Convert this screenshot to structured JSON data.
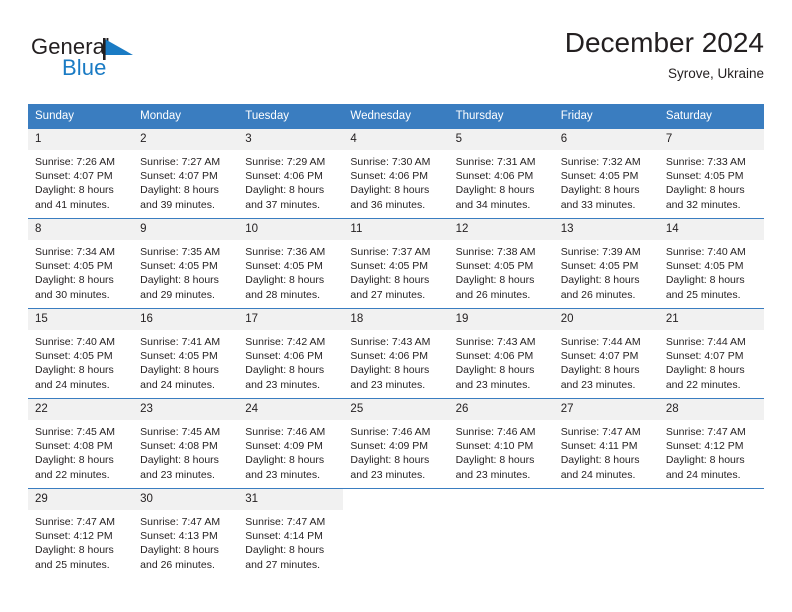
{
  "brand": {
    "name_part1": "General",
    "name_part2": "Blue",
    "flag_icon": "blue-flag-triangle-icon",
    "color_dark": "#231f20",
    "color_blue": "#1a7bc4"
  },
  "header": {
    "title": "December 2024",
    "subtitle": "Syrove, Ukraine"
  },
  "theme": {
    "header_row_bg": "#3a7dc0",
    "header_row_text": "#ffffff",
    "day_band_bg": "#f1f1f1",
    "grid_line": "#3a7dc0",
    "body_text": "#231f20"
  },
  "weekday_headers": [
    "Sunday",
    "Monday",
    "Tuesday",
    "Wednesday",
    "Thursday",
    "Friday",
    "Saturday"
  ],
  "weeks": [
    [
      {
        "day": "1",
        "sunrise": "Sunrise: 7:26 AM",
        "sunset": "Sunset: 4:07 PM",
        "daylight_line1": "Daylight: 8 hours",
        "daylight_line2": "and 41 minutes."
      },
      {
        "day": "2",
        "sunrise": "Sunrise: 7:27 AM",
        "sunset": "Sunset: 4:07 PM",
        "daylight_line1": "Daylight: 8 hours",
        "daylight_line2": "and 39 minutes."
      },
      {
        "day": "3",
        "sunrise": "Sunrise: 7:29 AM",
        "sunset": "Sunset: 4:06 PM",
        "daylight_line1": "Daylight: 8 hours",
        "daylight_line2": "and 37 minutes."
      },
      {
        "day": "4",
        "sunrise": "Sunrise: 7:30 AM",
        "sunset": "Sunset: 4:06 PM",
        "daylight_line1": "Daylight: 8 hours",
        "daylight_line2": "and 36 minutes."
      },
      {
        "day": "5",
        "sunrise": "Sunrise: 7:31 AM",
        "sunset": "Sunset: 4:06 PM",
        "daylight_line1": "Daylight: 8 hours",
        "daylight_line2": "and 34 minutes."
      },
      {
        "day": "6",
        "sunrise": "Sunrise: 7:32 AM",
        "sunset": "Sunset: 4:05 PM",
        "daylight_line1": "Daylight: 8 hours",
        "daylight_line2": "and 33 minutes."
      },
      {
        "day": "7",
        "sunrise": "Sunrise: 7:33 AM",
        "sunset": "Sunset: 4:05 PM",
        "daylight_line1": "Daylight: 8 hours",
        "daylight_line2": "and 32 minutes."
      }
    ],
    [
      {
        "day": "8",
        "sunrise": "Sunrise: 7:34 AM",
        "sunset": "Sunset: 4:05 PM",
        "daylight_line1": "Daylight: 8 hours",
        "daylight_line2": "and 30 minutes."
      },
      {
        "day": "9",
        "sunrise": "Sunrise: 7:35 AM",
        "sunset": "Sunset: 4:05 PM",
        "daylight_line1": "Daylight: 8 hours",
        "daylight_line2": "and 29 minutes."
      },
      {
        "day": "10",
        "sunrise": "Sunrise: 7:36 AM",
        "sunset": "Sunset: 4:05 PM",
        "daylight_line1": "Daylight: 8 hours",
        "daylight_line2": "and 28 minutes."
      },
      {
        "day": "11",
        "sunrise": "Sunrise: 7:37 AM",
        "sunset": "Sunset: 4:05 PM",
        "daylight_line1": "Daylight: 8 hours",
        "daylight_line2": "and 27 minutes."
      },
      {
        "day": "12",
        "sunrise": "Sunrise: 7:38 AM",
        "sunset": "Sunset: 4:05 PM",
        "daylight_line1": "Daylight: 8 hours",
        "daylight_line2": "and 26 minutes."
      },
      {
        "day": "13",
        "sunrise": "Sunrise: 7:39 AM",
        "sunset": "Sunset: 4:05 PM",
        "daylight_line1": "Daylight: 8 hours",
        "daylight_line2": "and 26 minutes."
      },
      {
        "day": "14",
        "sunrise": "Sunrise: 7:40 AM",
        "sunset": "Sunset: 4:05 PM",
        "daylight_line1": "Daylight: 8 hours",
        "daylight_line2": "and 25 minutes."
      }
    ],
    [
      {
        "day": "15",
        "sunrise": "Sunrise: 7:40 AM",
        "sunset": "Sunset: 4:05 PM",
        "daylight_line1": "Daylight: 8 hours",
        "daylight_line2": "and 24 minutes."
      },
      {
        "day": "16",
        "sunrise": "Sunrise: 7:41 AM",
        "sunset": "Sunset: 4:05 PM",
        "daylight_line1": "Daylight: 8 hours",
        "daylight_line2": "and 24 minutes."
      },
      {
        "day": "17",
        "sunrise": "Sunrise: 7:42 AM",
        "sunset": "Sunset: 4:06 PM",
        "daylight_line1": "Daylight: 8 hours",
        "daylight_line2": "and 23 minutes."
      },
      {
        "day": "18",
        "sunrise": "Sunrise: 7:43 AM",
        "sunset": "Sunset: 4:06 PM",
        "daylight_line1": "Daylight: 8 hours",
        "daylight_line2": "and 23 minutes."
      },
      {
        "day": "19",
        "sunrise": "Sunrise: 7:43 AM",
        "sunset": "Sunset: 4:06 PM",
        "daylight_line1": "Daylight: 8 hours",
        "daylight_line2": "and 23 minutes."
      },
      {
        "day": "20",
        "sunrise": "Sunrise: 7:44 AM",
        "sunset": "Sunset: 4:07 PM",
        "daylight_line1": "Daylight: 8 hours",
        "daylight_line2": "and 23 minutes."
      },
      {
        "day": "21",
        "sunrise": "Sunrise: 7:44 AM",
        "sunset": "Sunset: 4:07 PM",
        "daylight_line1": "Daylight: 8 hours",
        "daylight_line2": "and 22 minutes."
      }
    ],
    [
      {
        "day": "22",
        "sunrise": "Sunrise: 7:45 AM",
        "sunset": "Sunset: 4:08 PM",
        "daylight_line1": "Daylight: 8 hours",
        "daylight_line2": "and 22 minutes."
      },
      {
        "day": "23",
        "sunrise": "Sunrise: 7:45 AM",
        "sunset": "Sunset: 4:08 PM",
        "daylight_line1": "Daylight: 8 hours",
        "daylight_line2": "and 23 minutes."
      },
      {
        "day": "24",
        "sunrise": "Sunrise: 7:46 AM",
        "sunset": "Sunset: 4:09 PM",
        "daylight_line1": "Daylight: 8 hours",
        "daylight_line2": "and 23 minutes."
      },
      {
        "day": "25",
        "sunrise": "Sunrise: 7:46 AM",
        "sunset": "Sunset: 4:09 PM",
        "daylight_line1": "Daylight: 8 hours",
        "daylight_line2": "and 23 minutes."
      },
      {
        "day": "26",
        "sunrise": "Sunrise: 7:46 AM",
        "sunset": "Sunset: 4:10 PM",
        "daylight_line1": "Daylight: 8 hours",
        "daylight_line2": "and 23 minutes."
      },
      {
        "day": "27",
        "sunrise": "Sunrise: 7:47 AM",
        "sunset": "Sunset: 4:11 PM",
        "daylight_line1": "Daylight: 8 hours",
        "daylight_line2": "and 24 minutes."
      },
      {
        "day": "28",
        "sunrise": "Sunrise: 7:47 AM",
        "sunset": "Sunset: 4:12 PM",
        "daylight_line1": "Daylight: 8 hours",
        "daylight_line2": "and 24 minutes."
      }
    ],
    [
      {
        "day": "29",
        "sunrise": "Sunrise: 7:47 AM",
        "sunset": "Sunset: 4:12 PM",
        "daylight_line1": "Daylight: 8 hours",
        "daylight_line2": "and 25 minutes."
      },
      {
        "day": "30",
        "sunrise": "Sunrise: 7:47 AM",
        "sunset": "Sunset: 4:13 PM",
        "daylight_line1": "Daylight: 8 hours",
        "daylight_line2": "and 26 minutes."
      },
      {
        "day": "31",
        "sunrise": "Sunrise: 7:47 AM",
        "sunset": "Sunset: 4:14 PM",
        "daylight_line1": "Daylight: 8 hours",
        "daylight_line2": "and 27 minutes."
      },
      {
        "day": "",
        "sunrise": "",
        "sunset": "",
        "daylight_line1": "",
        "daylight_line2": ""
      },
      {
        "day": "",
        "sunrise": "",
        "sunset": "",
        "daylight_line1": "",
        "daylight_line2": ""
      },
      {
        "day": "",
        "sunrise": "",
        "sunset": "",
        "daylight_line1": "",
        "daylight_line2": ""
      },
      {
        "day": "",
        "sunrise": "",
        "sunset": "",
        "daylight_line1": "",
        "daylight_line2": ""
      }
    ]
  ]
}
